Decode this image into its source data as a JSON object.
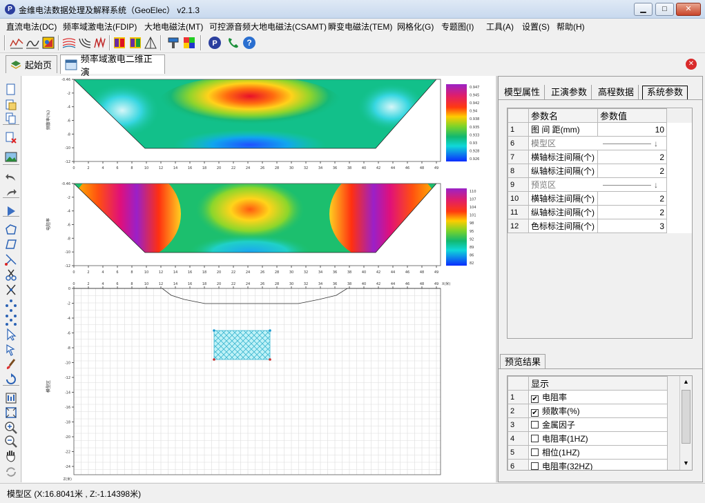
{
  "window": {
    "title": "金维电法数据处理及解释系统（GeoElec） v2.1.3",
    "icon_letter": "P",
    "minimize": "▁",
    "maximize": "□",
    "close": "✕"
  },
  "menu": [
    "直流电法(DC)",
    "频率域激电法(FDIP)",
    "大地电磁法(MT)",
    "可控源音频大地电磁法(CSAMT)",
    "瞬变电磁法(TEM)",
    "网格化(G)",
    "专题图(I)",
    "工具(A)",
    "设置(S)",
    "帮助(H)"
  ],
  "toolbar_icons": [
    "curve-icon",
    "curve-alt-icon",
    "color-map-icon",
    "multi-curve-icon",
    "multi-curve-alt-icon",
    "pseudo-section-icon",
    "model-a-icon",
    "model-b-icon",
    "triangle-icon",
    "paint-icon",
    "palette-icon",
    "logo-icon",
    "phone-icon",
    "help-icon"
  ],
  "tabs": {
    "home": "起始页",
    "forward": "频率域激电二维正演",
    "close_icon": "✕"
  },
  "left_tools": [
    "new-file-icon",
    "open-icon",
    "copy-icon",
    "delete-icon",
    "image-icon",
    "undo-icon",
    "redo-icon",
    "run-icon",
    "polygon-icon",
    "parallelogram-icon",
    "cut-line-icon",
    "scissors-icon",
    "split-icon",
    "nodes-icon",
    "nodes-alt-icon",
    "pointer-icon",
    "select-vertex-icon",
    "brush-icon",
    "rotate-icon",
    "fit-icon",
    "extent-icon",
    "zoom-in-icon",
    "zoom-out-icon",
    "pan-hand-icon",
    "refresh-icon"
  ],
  "plots": {
    "top": {
      "ylabel": "频散率(%)",
      "yticks": [
        "-0.46",
        "-2",
        "-4",
        "-6",
        "-8",
        "-10",
        "-12"
      ],
      "xticks": [
        "0",
        "2",
        "4",
        "6",
        "8",
        "10",
        "12",
        "14",
        "16",
        "18",
        "20",
        "22",
        "24",
        "26",
        "28",
        "30",
        "32",
        "34",
        "36",
        "38",
        "40",
        "42",
        "44",
        "46",
        "48",
        "49"
      ],
      "colorbar": [
        "0.947",
        "0.945",
        "0.942",
        "0.94",
        "0.938",
        "0.935",
        "0.933",
        "0.93",
        "0.928",
        "0.926"
      ]
    },
    "mid": {
      "ylabel": "电阻率",
      "yticks": [
        "-0.46",
        "-2",
        "-4",
        "-6",
        "-8",
        "-10",
        "-12"
      ],
      "xticks": [
        "0",
        "2",
        "4",
        "6",
        "8",
        "10",
        "12",
        "14",
        "16",
        "18",
        "20",
        "22",
        "24",
        "26",
        "28",
        "30",
        "32",
        "34",
        "36",
        "38",
        "40",
        "42",
        "44",
        "46",
        "48",
        "49"
      ],
      "colorbar": [
        "110",
        "107",
        "104",
        "101",
        "98",
        "95",
        "92",
        "89",
        "86",
        "82"
      ]
    },
    "model": {
      "ylabel": "模型区",
      "xunit": "X(米)",
      "zunit": "Z(米)",
      "xticks": [
        "0",
        "2",
        "4",
        "6",
        "8",
        "10",
        "12",
        "14",
        "16",
        "18",
        "20",
        "22",
        "24",
        "26",
        "28",
        "30",
        "32",
        "34",
        "36",
        "38",
        "40",
        "42",
        "44",
        "46",
        "48",
        "49"
      ],
      "yticks": [
        "0",
        "-2",
        "-4",
        "-6",
        "-8",
        "-10",
        "-12",
        "-14",
        "-16",
        "-18",
        "-20",
        "-22",
        "-24"
      ]
    }
  },
  "right_panel": {
    "tabs": [
      "模型属性",
      "正演参数",
      "高程数据",
      "系统参数"
    ],
    "active_tab": "系统参数",
    "param_header": {
      "name": "参数名",
      "value": "参数值"
    },
    "params": [
      {
        "row": "1",
        "name": "图 间 距(mm)",
        "value": "10",
        "type": "value"
      },
      {
        "row": "6",
        "name": "模型区",
        "value": "↓",
        "type": "group"
      },
      {
        "row": "7",
        "name": "横轴标注间隔(个)",
        "value": "2",
        "type": "value"
      },
      {
        "row": "8",
        "name": "纵轴标注间隔(个)",
        "value": "2",
        "type": "value"
      },
      {
        "row": "9",
        "name": "预览区",
        "value": "↓",
        "type": "group"
      },
      {
        "row": "10",
        "name": "横轴标注间隔(个)",
        "value": "2",
        "type": "value"
      },
      {
        "row": "11",
        "name": "纵轴标注间隔(个)",
        "value": "2",
        "type": "value"
      },
      {
        "row": "12",
        "name": "色标标注间隔(个)",
        "value": "3",
        "type": "value"
      }
    ],
    "preview_tab": "预览结果",
    "preview_header": "显示",
    "preview_rows": [
      {
        "row": "1",
        "label": "电阻率",
        "checked": true
      },
      {
        "row": "2",
        "label": "频散率(%)",
        "checked": true
      },
      {
        "row": "3",
        "label": "金属因子",
        "checked": false
      },
      {
        "row": "4",
        "label": "电阻率(1HZ)",
        "checked": false
      },
      {
        "row": "5",
        "label": "相位(1HZ)",
        "checked": false
      },
      {
        "row": "6",
        "label": "电阻率(32HZ)",
        "checked": false
      }
    ]
  },
  "status": "模型区  (X:16.8041米 , Z:-1.14398米)"
}
